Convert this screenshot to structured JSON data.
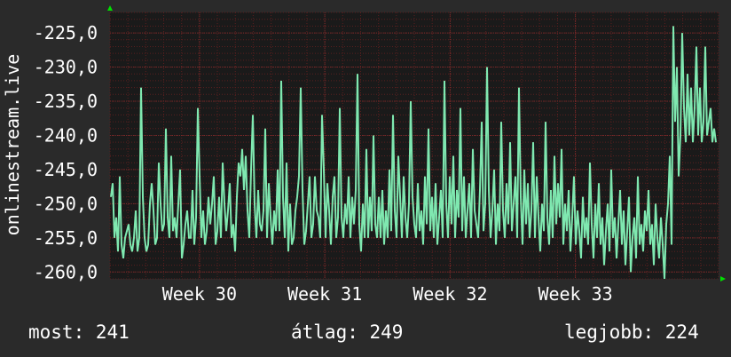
{
  "chart_data": {
    "type": "line",
    "ylabel": "onlinestream.live",
    "ylim": [
      -261.0,
      -222.0
    ],
    "yticks": [
      {
        "value": -225,
        "label": "-225,0"
      },
      {
        "value": -230,
        "label": "-230,0"
      },
      {
        "value": -235,
        "label": "-235,0"
      },
      {
        "value": -240,
        "label": "-240,0"
      },
      {
        "value": -245,
        "label": "-245,0"
      },
      {
        "value": -250,
        "label": "-250,0"
      },
      {
        "value": -255,
        "label": "-255,0"
      },
      {
        "value": -260,
        "label": "-260,0"
      }
    ],
    "xlim": [
      0,
      34
    ],
    "xticks": [
      {
        "value": 5,
        "label": "Week 30"
      },
      {
        "value": 12,
        "label": "Week 31"
      },
      {
        "value": 19,
        "label": "Week 32"
      },
      {
        "value": 26,
        "label": "Week 33"
      }
    ],
    "x_minor_step": 1,
    "y_minor_step": 1,
    "series": [
      {
        "color": "#7fe8b0",
        "values": [
          -249,
          -247,
          -255,
          -252,
          -257,
          -246,
          -256,
          -258,
          -255,
          -254,
          -253,
          -256,
          -257,
          -255,
          -251,
          -257,
          -255,
          -233,
          -249,
          -255,
          -257,
          -256,
          -250,
          -247,
          -251,
          -256,
          -255,
          -244,
          -250,
          -254,
          -253,
          -239,
          -252,
          -255,
          -243,
          -254,
          -252,
          -255,
          -250,
          -245,
          -258,
          -256,
          -253,
          -251,
          -255,
          -255,
          -248,
          -256,
          -252,
          -236,
          -246,
          -255,
          -251,
          -256,
          -254,
          -249,
          -253,
          -250,
          -246,
          -256,
          -254,
          -249,
          -255,
          -244,
          -250,
          -254,
          -251,
          -247,
          -255,
          -253,
          -257,
          -249,
          -244,
          -246,
          -242,
          -248,
          -243,
          -251,
          -255,
          -245,
          -237,
          -250,
          -255,
          -248,
          -253,
          -254,
          -251,
          -239,
          -255,
          -247,
          -252,
          -256,
          -251,
          -254,
          -245,
          -254,
          -232,
          -249,
          -255,
          -244,
          -257,
          -250,
          -256,
          -255,
          -251,
          -249,
          -246,
          -233,
          -248,
          -256,
          -254,
          -250,
          -246,
          -255,
          -253,
          -246,
          -251,
          -252,
          -255,
          -237,
          -245,
          -255,
          -247,
          -251,
          -256,
          -249,
          -246,
          -255,
          -252,
          -236,
          -252,
          -255,
          -250,
          -253,
          -246,
          -255,
          -249,
          -253,
          -248,
          -231,
          -253,
          -257,
          -250,
          -255,
          -242,
          -255,
          -249,
          -254,
          -240,
          -253,
          -255,
          -249,
          -255,
          -248,
          -256,
          -251,
          -255,
          -245,
          -254,
          -237,
          -251,
          -255,
          -243,
          -249,
          -255,
          -246,
          -252,
          -255,
          -250,
          -235,
          -249,
          -253,
          -255,
          -247,
          -254,
          -251,
          -256,
          -246,
          -253,
          -239,
          -254,
          -249,
          -255,
          -247,
          -256,
          -252,
          -248,
          -255,
          -232,
          -250,
          -255,
          -246,
          -253,
          -243,
          -255,
          -248,
          -252,
          -236,
          -254,
          -246,
          -255,
          -251,
          -247,
          -255,
          -242,
          -251,
          -253,
          -255,
          -248,
          -238,
          -254,
          -250,
          -230,
          -248,
          -255,
          -251,
          -245,
          -256,
          -250,
          -254,
          -238,
          -251,
          -255,
          -247,
          -253,
          -241,
          -254,
          -250,
          -246,
          -255,
          -233,
          -249,
          -256,
          -245,
          -253,
          -247,
          -255,
          -251,
          -241,
          -255,
          -246,
          -252,
          -257,
          -250,
          -254,
          -238,
          -252,
          -256,
          -248,
          -255,
          -243,
          -253,
          -247,
          -252,
          -242,
          -256,
          -250,
          -254,
          -248,
          -257,
          -252,
          -246,
          -256,
          -251,
          -254,
          -258,
          -249,
          -255,
          -252,
          -256,
          -244,
          -253,
          -258,
          -250,
          -255,
          -247,
          -256,
          -252,
          -259,
          -254,
          -250,
          -257,
          -245,
          -255,
          -252,
          -258,
          -253,
          -248,
          -256,
          -251,
          -259,
          -254,
          -249,
          -260,
          -255,
          -252,
          -258,
          -246,
          -256,
          -253,
          -257,
          -251,
          -254,
          -248,
          -256,
          -253,
          -259,
          -250,
          -255,
          -258,
          -252,
          -256,
          -261,
          -253,
          -250,
          -243,
          -256,
          -224,
          -238,
          -230,
          -246,
          -240,
          -225,
          -236,
          -241,
          -231,
          -240,
          -233,
          -241,
          -236,
          -227,
          -240,
          -233,
          -241,
          -238,
          -227,
          -240,
          -238,
          -236,
          -241,
          -239,
          -241
        ],
        "note_points": "approximate readings"
      }
    ]
  },
  "stats": {
    "current": "most: 241",
    "average": "átlag: 249",
    "best": "legjobb: 224"
  },
  "colors": {
    "background": "#2a2a2a",
    "plot_background": "#1a1a1a",
    "grid_minor": "#5a1f1f",
    "grid_major": "#7a2a2a",
    "line": "#7fe8b0",
    "arrow": "#00e000"
  }
}
